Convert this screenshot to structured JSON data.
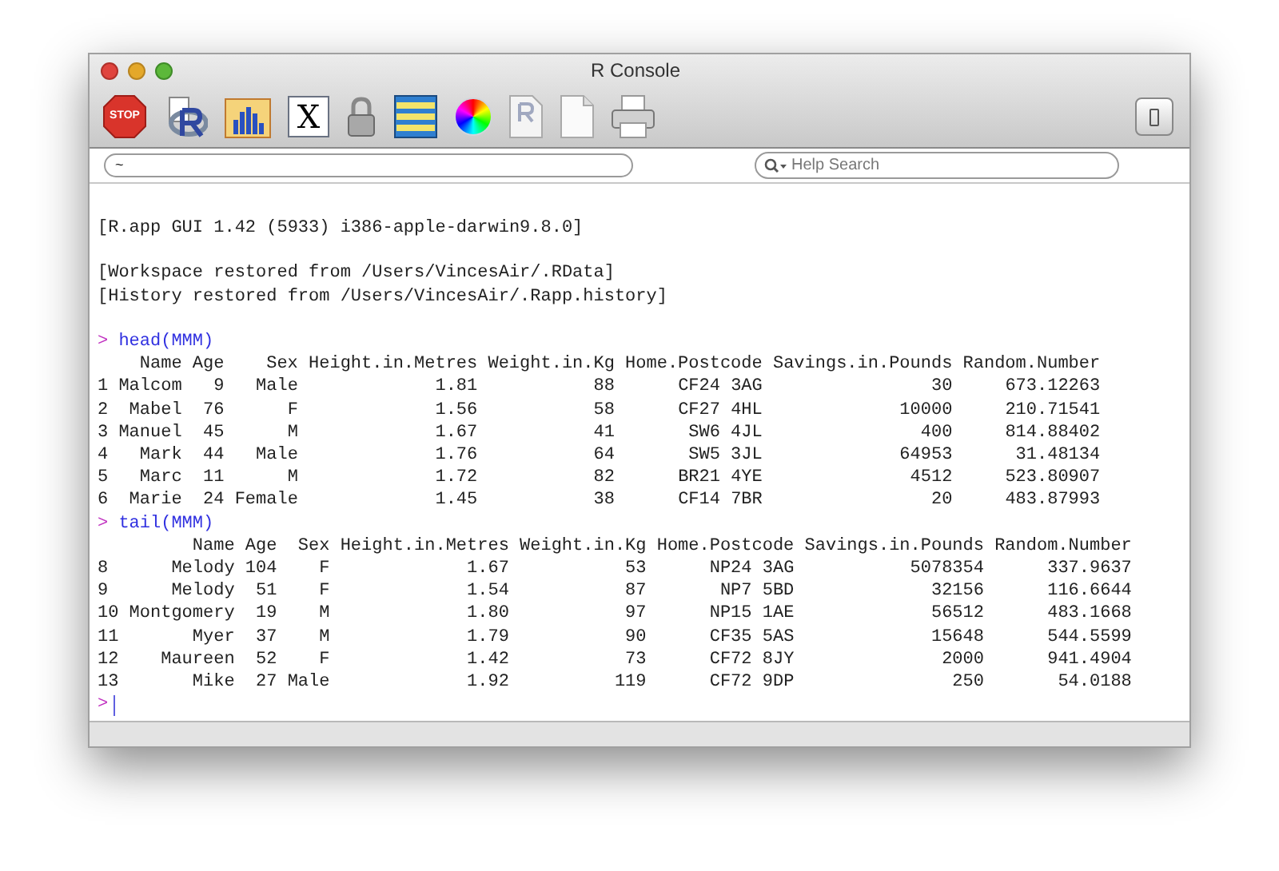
{
  "window": {
    "title": "R Console"
  },
  "toolbar": [
    {
      "kind": "stop",
      "label": "STOP"
    },
    {
      "kind": "source"
    },
    {
      "kind": "chart"
    },
    {
      "kind": "x11",
      "label": "X"
    },
    {
      "kind": "lock"
    },
    {
      "kind": "table"
    },
    {
      "kind": "color"
    },
    {
      "kind": "script"
    },
    {
      "kind": "document"
    },
    {
      "kind": "print"
    }
  ],
  "path_field": {
    "value": "~"
  },
  "help_search": {
    "placeholder": "Help Search"
  },
  "console": {
    "banner": "[R.app GUI 1.42 (5933) i386-apple-darwin9.8.0]",
    "messages": [
      "[Workspace restored from /Users/VincesAir/.RData]",
      "[History restored from /Users/VincesAir/.Rapp.history]"
    ],
    "blocks": [
      {
        "prompt": ">",
        "command": "head(MMM)",
        "columns": [
          "Name",
          "Age",
          "Sex",
          "Height.in.Metres",
          "Weight.in.Kg",
          "Home.Postcode",
          "Savings.in.Pounds",
          "Random.Number"
        ],
        "rows": [
          {
            "label": "1",
            "cells": [
              "Malcom",
              "9",
              "Male",
              "1.81",
              "88",
              "CF24 3AG",
              "30",
              "673.12263"
            ]
          },
          {
            "label": "2",
            "cells": [
              "Mabel",
              "76",
              "F",
              "1.56",
              "58",
              "CF27 4HL",
              "10000",
              "210.71541"
            ]
          },
          {
            "label": "3",
            "cells": [
              "Manuel",
              "45",
              "M",
              "1.67",
              "41",
              "SW6 4JL",
              "400",
              "814.88402"
            ]
          },
          {
            "label": "4",
            "cells": [
              "Mark",
              "44",
              "Male",
              "1.76",
              "64",
              "SW5 3JL",
              "64953",
              "31.48134"
            ]
          },
          {
            "label": "5",
            "cells": [
              "Marc",
              "11",
              "M",
              "1.72",
              "82",
              "BR21 4YE",
              "4512",
              "523.80907"
            ]
          },
          {
            "label": "6",
            "cells": [
              "Marie",
              "24",
              "Female",
              "1.45",
              "38",
              "CF14 7BR",
              "20",
              "483.87993"
            ]
          }
        ]
      },
      {
        "prompt": ">",
        "command": "tail(MMM)",
        "columns": [
          "Name",
          "Age",
          "Sex",
          "Height.in.Metres",
          "Weight.in.Kg",
          "Home.Postcode",
          "Savings.in.Pounds",
          "Random.Number"
        ],
        "rows": [
          {
            "label": "8",
            "cells": [
              "Melody",
              "104",
              "F",
              "1.67",
              "53",
              "NP24 3AG",
              "5078354",
              "337.9637"
            ]
          },
          {
            "label": "9",
            "cells": [
              "Melody",
              "51",
              "F",
              "1.54",
              "87",
              "NP7 5BD",
              "32156",
              "116.6644"
            ]
          },
          {
            "label": "10",
            "cells": [
              "Montgomery",
              "19",
              "M",
              "1.80",
              "97",
              "NP15 1AE",
              "56512",
              "483.1668"
            ]
          },
          {
            "label": "11",
            "cells": [
              "Myer",
              "37",
              "M",
              "1.79",
              "90",
              "CF35 5AS",
              "15648",
              "544.5599"
            ]
          },
          {
            "label": "12",
            "cells": [
              "Maureen",
              "52",
              "F",
              "1.42",
              "73",
              "CF72 8JY",
              "2000",
              "941.4904"
            ]
          },
          {
            "label": "13",
            "cells": [
              "Mike",
              "27",
              "Male",
              "1.92",
              "119",
              "CF72 9DP",
              "250",
              "54.0188"
            ]
          }
        ]
      }
    ],
    "input_prompt": ">"
  }
}
